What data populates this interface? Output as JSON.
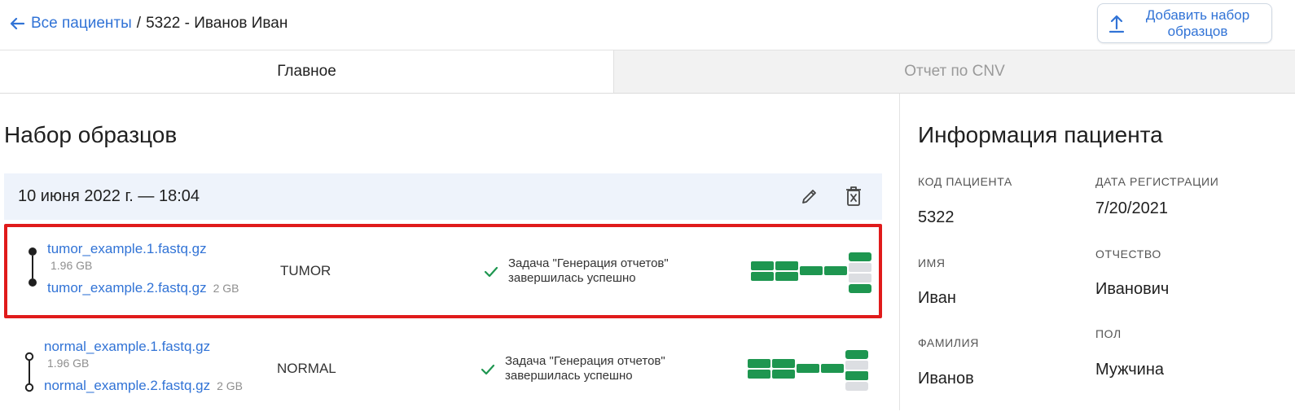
{
  "breadcrumb": {
    "back_label": "Все пациенты",
    "separator": "/",
    "current": "5322 - Иванов Иван"
  },
  "header": {
    "add_button_label": "Добавить набор образцов"
  },
  "tabs": [
    {
      "label": "Главное",
      "active": true
    },
    {
      "label": "Отчет по CNV",
      "active": false
    }
  ],
  "sample_set": {
    "section_title": "Набор образцов",
    "date_label": "10 июня 2022 г. — 18:04",
    "samples": [
      {
        "file1": "tumor_example.1.fastq.gz",
        "file1_size": "1.96 GB",
        "file2": "tumor_example.2.fastq.gz",
        "file2_size": "2 GB",
        "type": "TUMOR",
        "status_line1": "Задача \"Генерация отчетов\"",
        "status_line2": "завершилась успешно",
        "highlighted": true
      },
      {
        "file1": "normal_example.1.fastq.gz",
        "file1_size": "1.96 GB",
        "file2": "normal_example.2.fastq.gz",
        "file2_size": "2 GB",
        "type": "NORMAL",
        "status_line1": "Задача \"Генерация отчетов\"",
        "status_line2": "завершилась успешно",
        "highlighted": false
      }
    ]
  },
  "patient_info": {
    "title": "Информация пациента",
    "fields": [
      {
        "label": "КОД ПАЦИЕНТА",
        "value": "5322"
      },
      {
        "label": "ДАТА РЕГИСТРАЦИИ",
        "value": "7/20/2021"
      },
      {
        "label": "ИМЯ",
        "value": "Иван"
      },
      {
        "label": "ОТЧЕСТВО",
        "value": "Иванович"
      },
      {
        "label": "ФАМИЛИЯ",
        "value": "Иванов"
      },
      {
        "label": "ПОЛ",
        "value": "Мужчина"
      }
    ]
  },
  "colors": {
    "accent": "#3173d6",
    "success": "#1e9650",
    "highlight_border": "#e01b1b",
    "progress_inactive": "#dcdee2"
  },
  "icons": {
    "back": "arrow-left-icon",
    "upload": "upload-icon",
    "edit": "pencil-icon",
    "delete": "trash-icon",
    "status": "check-icon"
  }
}
